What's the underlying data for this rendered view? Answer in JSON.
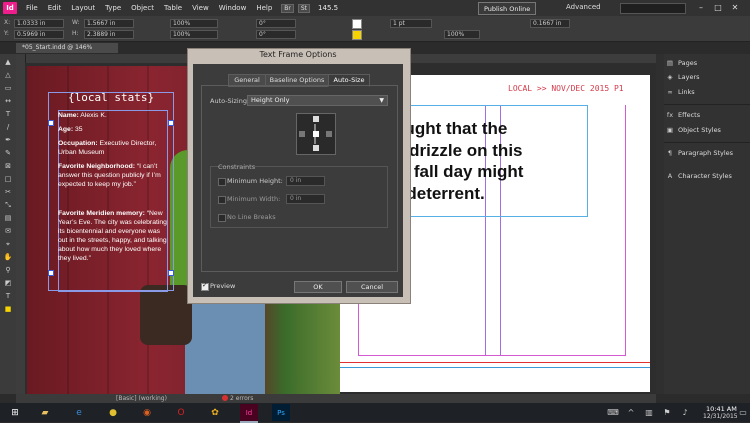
{
  "app": {
    "logo": "Id",
    "menu": [
      "File",
      "Edit",
      "Layout",
      "Type",
      "Object",
      "Table",
      "View",
      "Window",
      "Help"
    ],
    "badges": [
      "Br",
      "St"
    ],
    "zoom": "145.5",
    "publish_label": "Publish Online",
    "workspace": "Advanced",
    "win_buttons": [
      "–",
      "□",
      "✕"
    ]
  },
  "control_bar": {
    "x_value": "1.0333 in",
    "y_value": "0.5969 in",
    "w_value": "1.5667 in",
    "h_value": "2.3889 in",
    "scale_x": "100%",
    "scale_y": "100%",
    "angle": "0°",
    "shear": "0°",
    "stroke_weight": "1 pt",
    "stroke_ratio": "100%",
    "width_field": "0.1667 in"
  },
  "document_tab": "*05_Start.indd @ 146%",
  "status_bar": {
    "style": "[Basic] (working)",
    "errors": "2 errors"
  },
  "spread": {
    "running_head": "LOCAL >> NOV/DEC 2015  P1",
    "headline_lines": [
      "thought that the",
      "ght drizzle on this",
      "risp fall day might",
      "e a deterrent."
    ],
    "card_title": "{local stats}",
    "card": [
      {
        "label": "Name:",
        "value": " Alexis K."
      },
      {
        "label": "Age:",
        "value": " 35"
      },
      {
        "label": "Occupation:",
        "value": " Executive Director, Urban Museum"
      },
      {
        "label": "Favorite Neighborhood:",
        "value": " “I can’t answer this question publicly if I’m expected to keep my job.”"
      },
      {
        "label": "Favorite Meridien memory:",
        "value": " “New Year’s Eve. The city was celebrating its bicentennial and everyone was out in the streets, happy, and talking about how much they loved where they lived.”"
      }
    ]
  },
  "dialog": {
    "title": "Text Frame Options",
    "tabs": [
      "General",
      "Baseline Options",
      "Auto-Size"
    ],
    "active_tab": "Auto-Size",
    "auto_sizing_label": "Auto-Sizing",
    "auto_sizing_value": "Height Only",
    "constraints_label": "Constraints",
    "min_height_label": "Minimum Height:",
    "min_height_value": "0 in",
    "min_width_label": "Minimum Width:",
    "min_width_value": "0 in",
    "no_line_breaks_label": "No Line Breaks",
    "preview_label": "Preview",
    "preview_checked": true,
    "ok_label": "OK",
    "cancel_label": "Cancel"
  },
  "panels": [
    {
      "icon": "pages-icon",
      "label": "Pages"
    },
    {
      "icon": "layers-icon",
      "label": "Layers"
    },
    {
      "icon": "links-icon",
      "label": "Links"
    },
    {
      "icon": "effects-icon",
      "label": "Effects"
    },
    {
      "icon": "object-styles-icon",
      "label": "Object Styles"
    },
    {
      "icon": "paragraph-styles-icon",
      "label": "Paragraph Styles"
    },
    {
      "icon": "character-styles-icon",
      "label": "Character Styles"
    }
  ],
  "taskbar": {
    "time": "10:41 AM",
    "date": "12/31/2015"
  },
  "colors": {
    "accent_pink": "#f01e8c",
    "running_head_red": "#d43a4a",
    "photo_red": "#8a2530"
  }
}
